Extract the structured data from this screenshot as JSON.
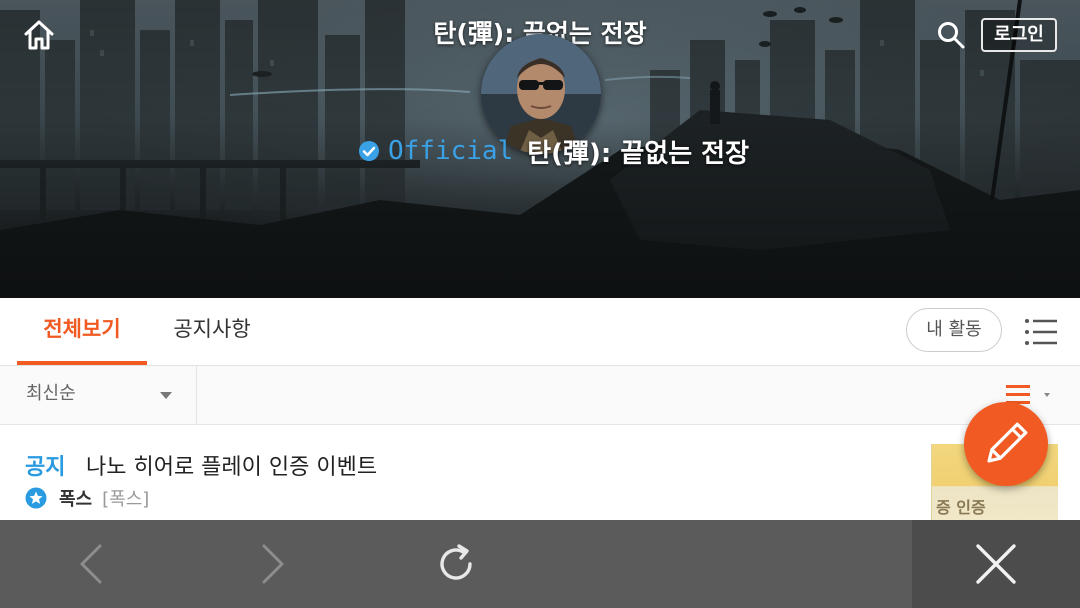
{
  "header": {
    "title": "탄(彈): 끝없는 전장",
    "login_label": "로그인",
    "official_label": "Official",
    "community_name": "탄(彈): 끝없는 전장"
  },
  "tabs": [
    {
      "label": "전체보기",
      "active": true
    },
    {
      "label": "공지사항",
      "active": false
    }
  ],
  "my_activity_label": "내 활동",
  "sort": {
    "selected": "최신순"
  },
  "posts": [
    {
      "badge": "공지",
      "title": "나노 히어로 플레이 인증 이벤트",
      "author": "폭스",
      "author_tag": "[폭스]",
      "thumbnail_text": "증 인증"
    }
  ],
  "colors": {
    "accent": "#f15a22",
    "notice_blue": "#2a9be0",
    "official_blue": "#3aa1e6",
    "bottom_bar": "#5b5b5b"
  },
  "icons": [
    "home-icon",
    "search-icon",
    "verified-icon",
    "menu-icon",
    "list-view-icon",
    "pencil-icon",
    "star-icon",
    "back-icon",
    "forward-icon",
    "refresh-icon",
    "close-icon"
  ]
}
